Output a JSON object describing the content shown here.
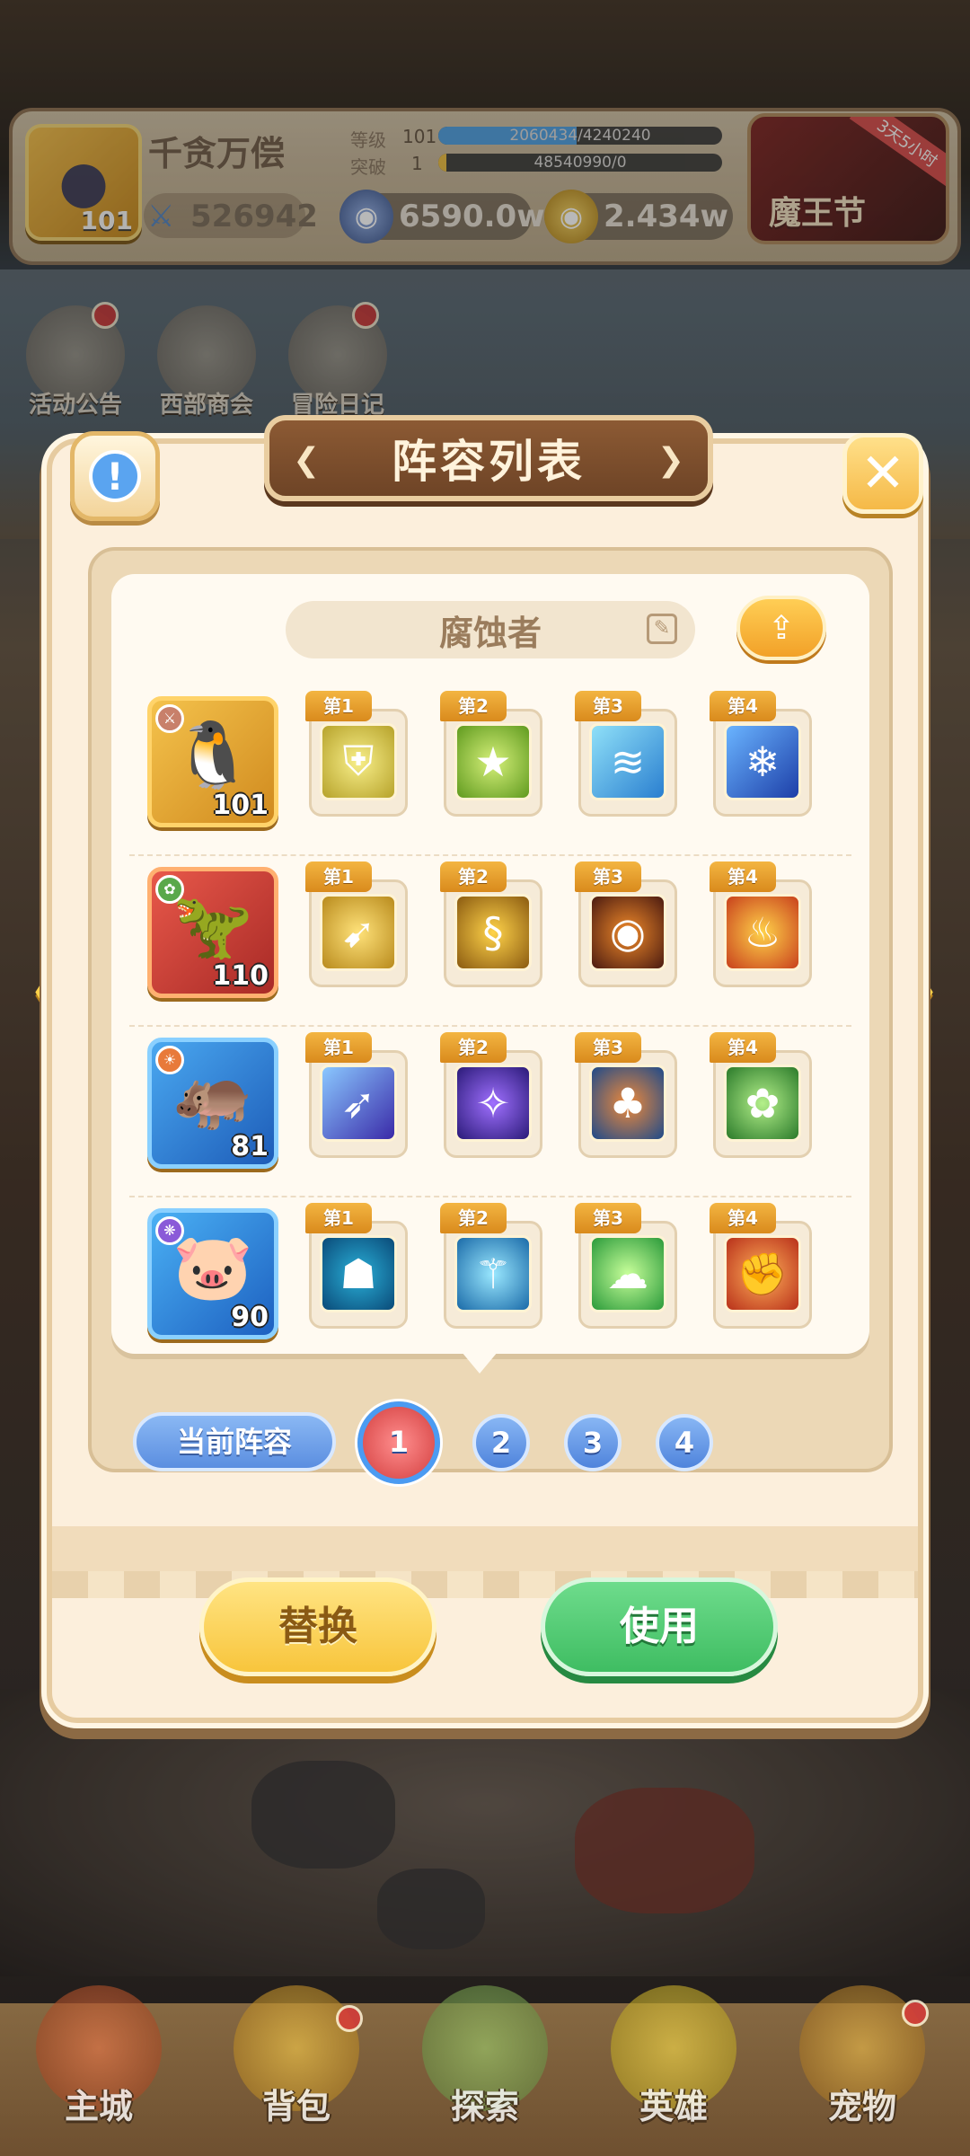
{
  "hud": {
    "player_name": "千贪万偿",
    "player_level": "101",
    "power": "526942",
    "level_label": "等级",
    "level_value": "101",
    "exp_text": "2060434/4240240",
    "exp_progress": 0.486,
    "break_label": "突破",
    "break_value": "1",
    "break_text": "48540990/0",
    "break_progress": 1.0,
    "currency_1": "6590.0w",
    "currency_2": "2.434w",
    "event_title": "魔王节",
    "event_badge": "3天5小时"
  },
  "shortcuts": [
    {
      "label": "活动公告"
    },
    {
      "label": "西部商会"
    },
    {
      "label": "冒险日记"
    }
  ],
  "modal": {
    "title": "阵容列表",
    "lineup_name": "腐蚀者",
    "current_lineup_label": "当前阵容",
    "pages": [
      "1",
      "2",
      "3",
      "4"
    ],
    "active_page": "1",
    "replace_label": "替换",
    "use_label": "使用",
    "rows": [
      {
        "hero_level": "101",
        "skills": [
          {
            "tag": "第1",
            "icon": "shield-icon"
          },
          {
            "tag": "第2",
            "icon": "star-shield-icon"
          },
          {
            "tag": "第3",
            "icon": "water-wave-icon"
          },
          {
            "tag": "第4",
            "icon": "ice-wave-icon"
          }
        ]
      },
      {
        "hero_level": "110",
        "skills": [
          {
            "tag": "第1",
            "icon": "charge-icon"
          },
          {
            "tag": "第2",
            "icon": "golden-serpent-icon"
          },
          {
            "tag": "第3",
            "icon": "fire-eye-icon"
          },
          {
            "tag": "第4",
            "icon": "dragon-icon"
          }
        ]
      },
      {
        "hero_level": "81",
        "skills": [
          {
            "tag": "第1",
            "icon": "arrow-strike-icon"
          },
          {
            "tag": "第2",
            "icon": "arcane-rain-icon"
          },
          {
            "tag": "第3",
            "icon": "treant-icon"
          },
          {
            "tag": "第4",
            "icon": "healing-flower-icon"
          }
        ]
      },
      {
        "hero_level": "90",
        "skills": [
          {
            "tag": "第1",
            "icon": "mask-icon"
          },
          {
            "tag": "第2",
            "icon": "trident-icon"
          },
          {
            "tag": "第3",
            "icon": "toxic-cloud-icon"
          },
          {
            "tag": "第4",
            "icon": "fist-icon"
          }
        ]
      }
    ]
  },
  "bottom_nav": [
    {
      "label": "主城"
    },
    {
      "label": "背包"
    },
    {
      "label": "探索"
    },
    {
      "label": "英雄"
    },
    {
      "label": "宠物"
    }
  ]
}
